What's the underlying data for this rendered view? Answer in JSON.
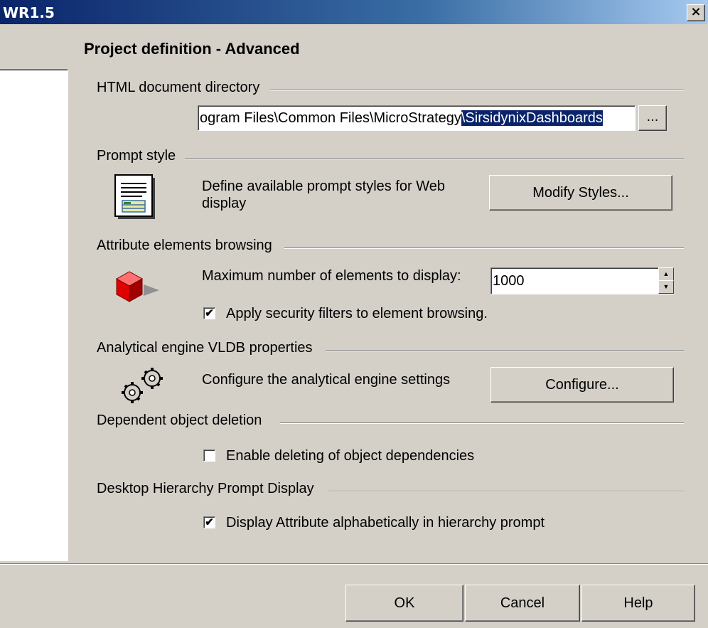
{
  "window": {
    "title": "WR1.5",
    "close_glyph": "×"
  },
  "page": {
    "heading": "Project definition - Advanced"
  },
  "html_dir": {
    "label": "HTML document directory",
    "path_plain": "ogram Files\\Common Files\\MicroStrategy",
    "path_selected": "\\SirsidynixDashboards",
    "browse_label": "..."
  },
  "prompt_style": {
    "label": "Prompt style",
    "description": "Define available prompt styles for Web display",
    "button": "Modify Styles...",
    "icon": "document-list-icon"
  },
  "attr_browsing": {
    "label": "Attribute elements browsing",
    "max_label": "Maximum number of elements to display:",
    "max_value": "1000",
    "security_checked": true,
    "security_label": "Apply security filters to element browsing.",
    "icon": "red-cube-icon"
  },
  "vldb": {
    "label": "Analytical engine VLDB properties",
    "description": "Configure the analytical engine settings",
    "button": "Configure...",
    "icon": "gears-icon"
  },
  "dep_deletion": {
    "label": "Dependent object deletion",
    "checked": false,
    "check_label": "Enable deleting of object dependencies"
  },
  "hierarchy": {
    "label": "Desktop Hierarchy Prompt Display",
    "checked": true,
    "check_label": "Display Attribute alphabetically in hierarchy prompt"
  },
  "footer": {
    "ok": "OK",
    "cancel": "Cancel",
    "help": "Help"
  },
  "check_glyph": "✔"
}
